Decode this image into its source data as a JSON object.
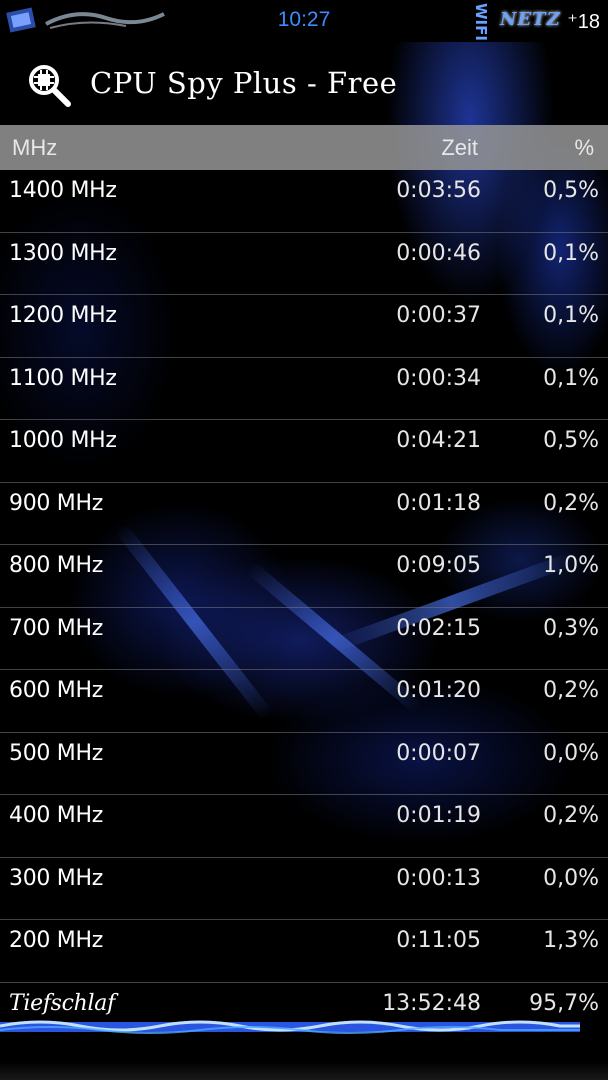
{
  "status_bar": {
    "time": "10:27",
    "right_label": "NETZ",
    "wifi_label": "WIFI",
    "badge": "⁺18"
  },
  "app": {
    "title": "CPU Spy Plus - Free",
    "icon": "cpu-magnifier-icon"
  },
  "table": {
    "headers": {
      "freq": "MHz",
      "time": "Zeit",
      "pct": "%"
    },
    "rows": [
      {
        "freq": "1400 MHz",
        "time": "0:03:56",
        "pct": "0,5%"
      },
      {
        "freq": "1300 MHz",
        "time": "0:00:46",
        "pct": "0,1%"
      },
      {
        "freq": "1200 MHz",
        "time": "0:00:37",
        "pct": "0,1%"
      },
      {
        "freq": "1100 MHz",
        "time": "0:00:34",
        "pct": "0,1%"
      },
      {
        "freq": "1000 MHz",
        "time": "0:04:21",
        "pct": "0,5%"
      },
      {
        "freq": "900 MHz",
        "time": "0:01:18",
        "pct": "0,2%"
      },
      {
        "freq": "800 MHz",
        "time": "0:09:05",
        "pct": "1,0%"
      },
      {
        "freq": "700 MHz",
        "time": "0:02:15",
        "pct": "0,3%"
      },
      {
        "freq": "600 MHz",
        "time": "0:01:20",
        "pct": "0,2%"
      },
      {
        "freq": "500 MHz",
        "time": "0:00:07",
        "pct": "0,0%"
      },
      {
        "freq": "400 MHz",
        "time": "0:01:19",
        "pct": "0,2%"
      },
      {
        "freq": "300 MHz",
        "time": "0:00:13",
        "pct": "0,0%"
      },
      {
        "freq": "200 MHz",
        "time": "0:11:05",
        "pct": "1,3%"
      },
      {
        "freq": "Tiefschlaf",
        "time": "13:52:48",
        "pct": "95,7%"
      }
    ]
  },
  "colors": {
    "accent": "#3b8cff",
    "header_bg": "#969696",
    "bar": "#3a6bff"
  }
}
